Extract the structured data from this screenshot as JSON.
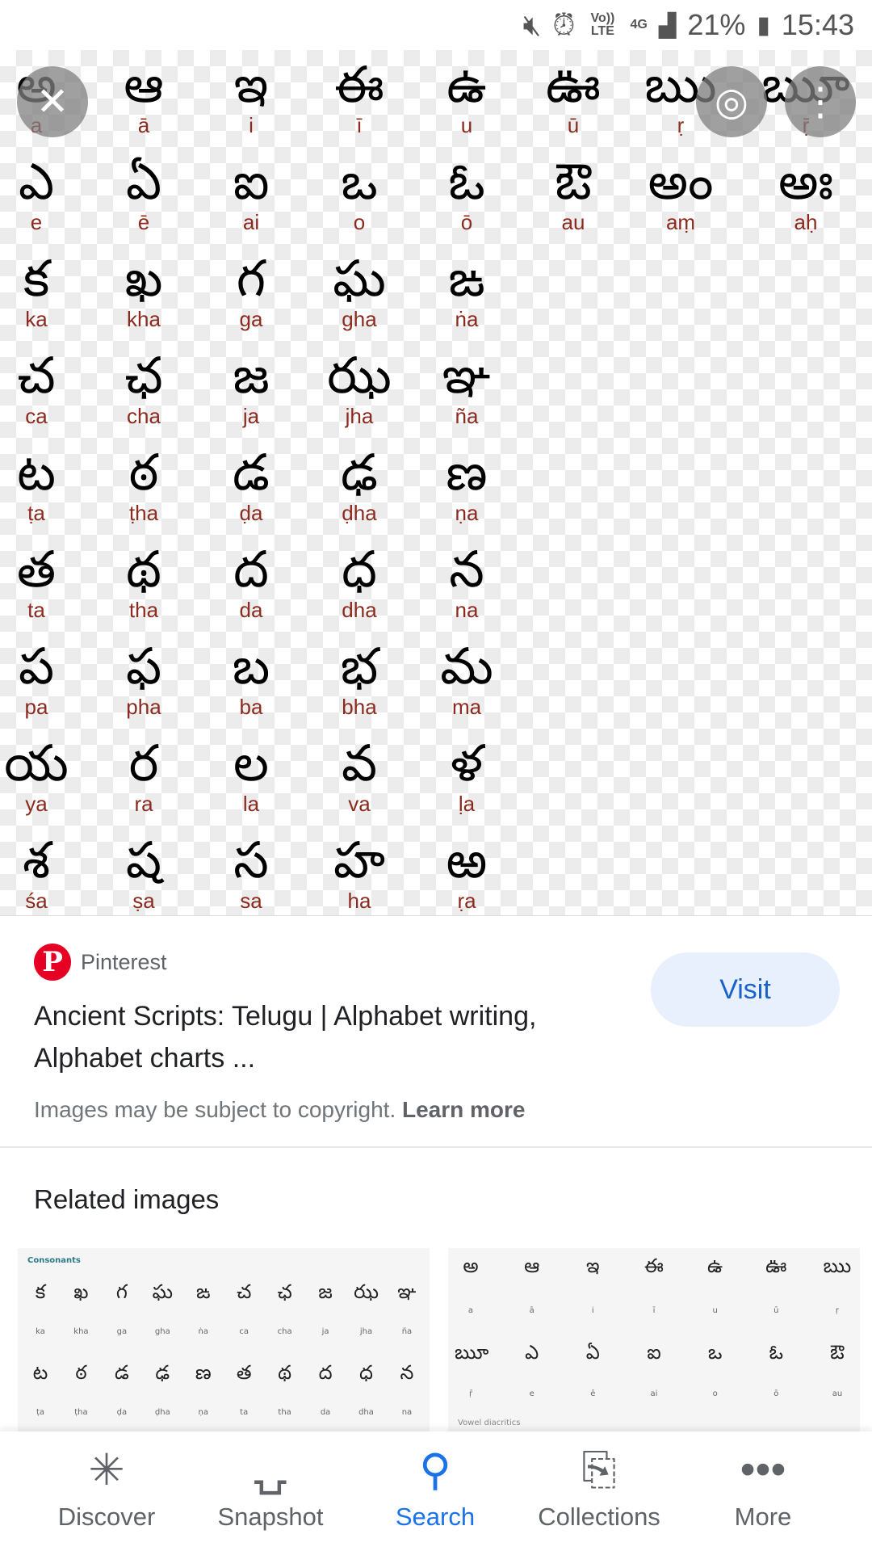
{
  "status_bar": {
    "icons": [
      "mute-icon",
      "alarm-icon",
      "volte-icon",
      "4g-icon",
      "signal-icon",
      "battery-icon"
    ],
    "volte": "Vo)) LTE",
    "network": "4G",
    "battery": "21%",
    "time": "15:43"
  },
  "image": {
    "rows": [
      [
        [
          "అ",
          "a"
        ],
        [
          "ఆ",
          "ā"
        ],
        [
          "ఇ",
          "i"
        ],
        [
          "ఈ",
          "ī"
        ],
        [
          "ఉ",
          "u"
        ],
        [
          "ఊ",
          "ū"
        ],
        [
          "ఋ",
          "ṛ"
        ],
        [
          "ౠ",
          "ṝ"
        ]
      ],
      [
        [
          "ఎ",
          "e"
        ],
        [
          "ఏ",
          "ē"
        ],
        [
          "ఐ",
          "ai"
        ],
        [
          "ఒ",
          "o"
        ],
        [
          "ఓ",
          "ō"
        ],
        [
          "ఔ",
          "au"
        ],
        [
          "అం",
          "aṃ"
        ],
        [
          "అః",
          "aḥ"
        ]
      ],
      [
        [
          "క",
          "ka"
        ],
        [
          "ఖ",
          "kha"
        ],
        [
          "గ",
          "ga"
        ],
        [
          "ఘ",
          "gha"
        ],
        [
          "ఙ",
          "ṅa"
        ]
      ],
      [
        [
          "చ",
          "ca"
        ],
        [
          "ఛ",
          "cha"
        ],
        [
          "జ",
          "ja"
        ],
        [
          "ఝ",
          "jha"
        ],
        [
          "ఞ",
          "ña"
        ]
      ],
      [
        [
          "ట",
          "ṭa"
        ],
        [
          "ఠ",
          "ṭha"
        ],
        [
          "డ",
          "ḍa"
        ],
        [
          "ఢ",
          "ḍha"
        ],
        [
          "ణ",
          "ṇa"
        ]
      ],
      [
        [
          "త",
          "ta"
        ],
        [
          "థ",
          "tha"
        ],
        [
          "ద",
          "da"
        ],
        [
          "ధ",
          "dha"
        ],
        [
          "న",
          "na"
        ]
      ],
      [
        [
          "ప",
          "pa"
        ],
        [
          "ఫ",
          "pha"
        ],
        [
          "బ",
          "ba"
        ],
        [
          "భ",
          "bha"
        ],
        [
          "మ",
          "ma"
        ]
      ],
      [
        [
          "య",
          "ya"
        ],
        [
          "ర",
          "ra"
        ],
        [
          "ల",
          "la"
        ],
        [
          "వ",
          "va"
        ],
        [
          "ళ",
          "ḷa"
        ]
      ],
      [
        [
          "శ",
          "śa"
        ],
        [
          "ష",
          "ṣa"
        ],
        [
          "స",
          "sa"
        ],
        [
          "హ",
          "ha"
        ],
        [
          "ఱ",
          "ṛa"
        ]
      ]
    ]
  },
  "overlay": {
    "close": "✕",
    "lens": "◎",
    "more": "⋮"
  },
  "result": {
    "source": "Pinterest",
    "logo_letter": "P",
    "brand_color": "#e60023",
    "visit": "Visit",
    "title": "Ancient Scripts: Telugu | Alphabet writing, Alphabet charts ...",
    "copyright": "Images may be subject to copyright.",
    "learn_more": "Learn more"
  },
  "related": {
    "heading": "Related images",
    "thumb1": {
      "caption": "Consonants",
      "row1": [
        "క",
        "ఖ",
        "గ",
        "ఘ",
        "ఙ",
        "చ",
        "ఛ",
        "జ",
        "ఝ",
        "ఞ"
      ],
      "row1_labels": [
        "ka",
        "kha",
        "ga",
        "gha",
        "ṅa",
        "ca",
        "cha",
        "ja",
        "jha",
        "ña"
      ],
      "row2": [
        "ట",
        "ఠ",
        "డ",
        "ఢ",
        "ణ",
        "త",
        "థ",
        "ద",
        "ధ",
        "న"
      ],
      "row2_labels": [
        "ṭa",
        "ṭha",
        "ḍa",
        "ḍha",
        "ṇa",
        "ta",
        "tha",
        "da",
        "dha",
        "na"
      ]
    },
    "thumb2": {
      "caption": "Vowel diacritics",
      "row1": [
        "అ",
        "ఆ",
        "ఇ",
        "ఈ",
        "ఉ",
        "ఊ",
        "ఋ"
      ],
      "row1_labels": [
        "a",
        "ā",
        "i",
        "ī",
        "u",
        "ū",
        "ṛ"
      ],
      "row2": [
        "ౠ",
        "ఎ",
        "ఏ",
        "ఐ",
        "ఒ",
        "ఓ",
        "ఔ"
      ],
      "row2_labels": [
        "ṝ",
        "e",
        "ē",
        "ai",
        "o",
        "ō",
        "au"
      ]
    }
  },
  "nav": [
    {
      "label": "Discover",
      "icon": "✳"
    },
    {
      "label": "Snapshot",
      "icon": "⍽"
    },
    {
      "label": "Search",
      "icon": "⚲",
      "active": true,
      "color": "#1a73e8"
    },
    {
      "label": "Collections",
      "icon": "⎘"
    },
    {
      "label": "More",
      "icon": "•••"
    }
  ]
}
